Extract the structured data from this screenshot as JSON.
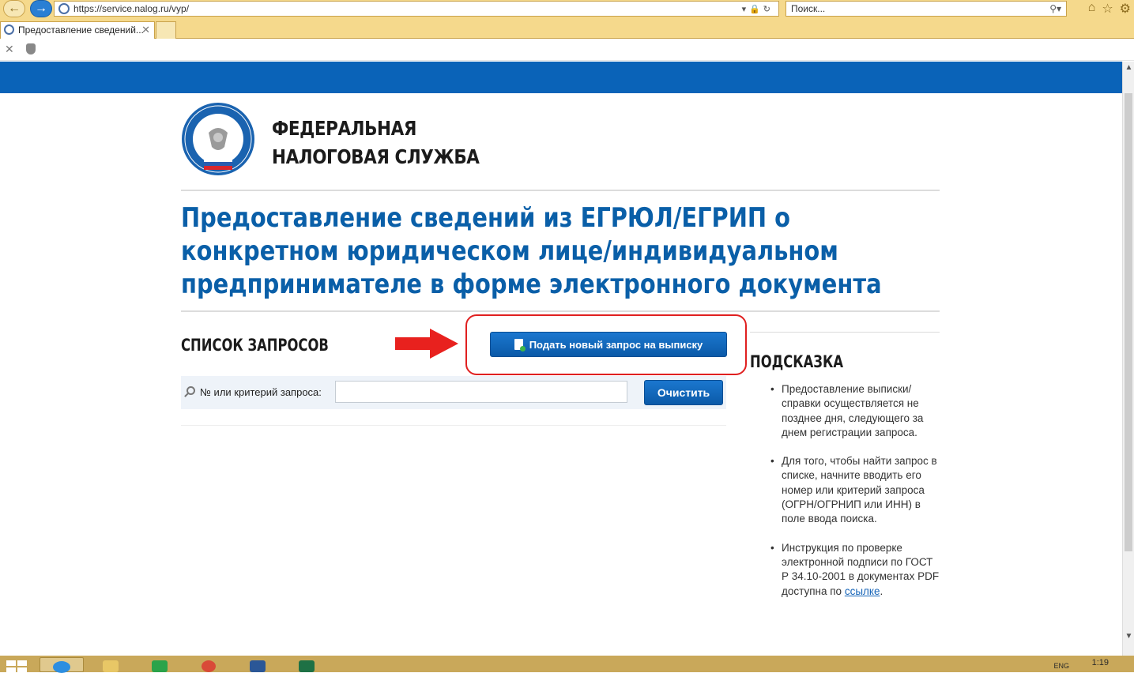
{
  "browser": {
    "url": "https://service.nalog.ru/vyp/",
    "search_placeholder": "Поиск...",
    "tab_title": "Предоставление сведений...",
    "tab_close": "✕",
    "url_tools": "▾🔒↻",
    "search_tools": "⚲▾",
    "top_icons": [
      "home-icon",
      "star-icon",
      "gear-icon"
    ]
  },
  "org": {
    "line1": "Федеральная",
    "line2": "налоговая служба"
  },
  "page": {
    "title": "Предоставление сведений из ЕГРЮЛ/ЕГРИП о конкретном юридическом лице/индивидуальном предпринимателе в форме электронного документа"
  },
  "requests": {
    "heading": "Список запросов",
    "new_request_button": "Подать новый запрос на выписку",
    "search_label": "№ или критерий запроса:",
    "search_value": "",
    "clear_button": "Очистить"
  },
  "hints": {
    "heading": "Подсказка",
    "items": [
      "Предоставление выписки/справки осуществляется не позднее дня, следующего за днем регистрации запроса.",
      "Для того, чтобы найти запрос в списке, начните вводить его номер или критерий запроса (ОГРН/ОГРНИП или ИНН) в поле ввода поиска.",
      "Инструкция по проверке электронной подписи по ГОСТ Р 34.10-2001 в документах PDF доступна по "
    ],
    "link_text": "ссылке",
    "link_suffix": "."
  },
  "taskbar": {
    "time": "1:19",
    "lang": "ENG",
    "apps": [
      "internet-explorer-icon",
      "file-explorer-icon",
      "store-icon",
      "chrome-icon",
      "word-icon",
      "excel-icon"
    ]
  },
  "colors": {
    "brand_blue": "#0a63b8",
    "title_blue": "#0a5fa8",
    "highlight_red": "#e02020",
    "browser_chrome": "#f5d98c"
  }
}
